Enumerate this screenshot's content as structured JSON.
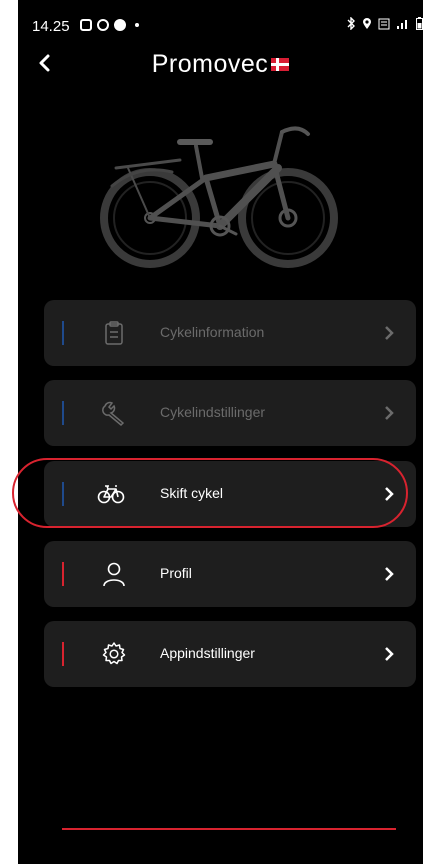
{
  "status_bar": {
    "time": "14.25",
    "left_icons": [
      "gallery-icon",
      "sync-icon",
      "message-icon"
    ],
    "right_icons": [
      "bluetooth-icon",
      "location-icon",
      "volte-icon",
      "signal-icon",
      "battery-icon"
    ]
  },
  "header": {
    "brand": "Promovec",
    "flag": "denmark-flag"
  },
  "menu": {
    "items": [
      {
        "label": "Cykelinformation",
        "icon": "clipboard-icon",
        "enabled": false,
        "accent": "#1f4a8c"
      },
      {
        "label": "Cykelindstillinger",
        "icon": "wrench-icon",
        "enabled": false,
        "accent": "#1f4a8c"
      },
      {
        "label": "Skift cykel",
        "icon": "bike-icon",
        "enabled": true,
        "accent": "#1f4a8c"
      },
      {
        "label": "Profil",
        "icon": "person-icon",
        "enabled": true,
        "accent": "#d8232f"
      },
      {
        "label": "Appindstillinger",
        "icon": "gear-icon",
        "enabled": true,
        "accent": "#d8232f"
      }
    ]
  },
  "colors": {
    "background": "#000000",
    "card": "#1e1e1e",
    "accent_red": "#d8232f",
    "accent_blue": "#1f4a8c"
  }
}
